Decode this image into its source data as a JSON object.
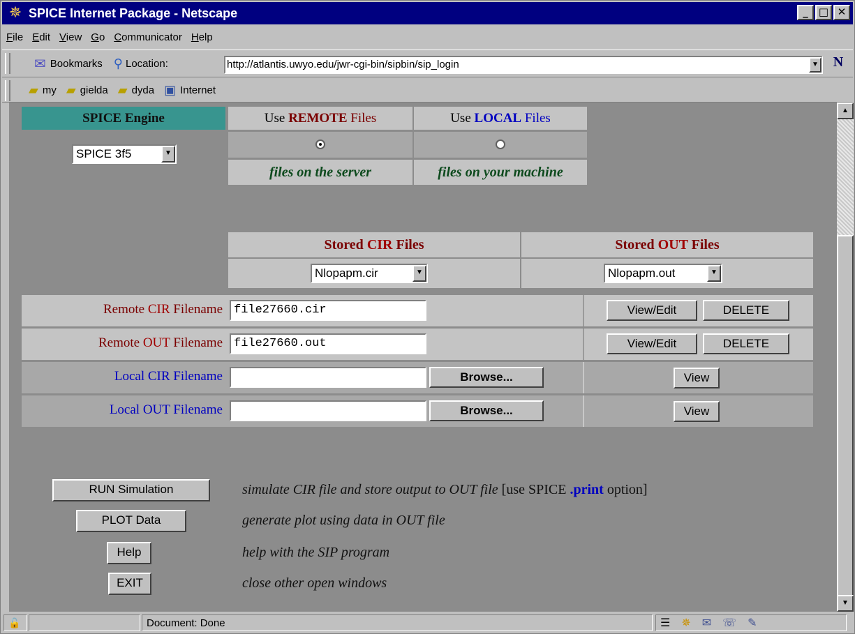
{
  "window": {
    "title": "SPICE Internet Package - Netscape",
    "min": "_",
    "max": "□",
    "close": "✕"
  },
  "menu": [
    "File",
    "Edit",
    "View",
    "Go",
    "Communicator",
    "Help"
  ],
  "location": {
    "bookmarks": "Bookmarks",
    "label": "Location:",
    "url": "http://atlantis.uwyo.edu/jwr-cgi-bin/sipbin/sip_login"
  },
  "personal": [
    {
      "label": "my"
    },
    {
      "label": "gielda"
    },
    {
      "label": "dyda"
    },
    {
      "label": "Internet"
    }
  ],
  "engine": {
    "header": "SPICE Engine",
    "selected": "SPICE 3f5"
  },
  "remote": {
    "pre": "Use ",
    "word": "REMOTE",
    "post": " Files",
    "desc": "files on the server",
    "selected": true
  },
  "local": {
    "pre": "Use ",
    "word": "LOCAL",
    "post": " Files",
    "desc": "files on your machine",
    "selected": false
  },
  "stored_cir": {
    "pre": "Stored ",
    "word": "CIR",
    "post": " Files",
    "selected": "Nlopapm.cir"
  },
  "stored_out": {
    "pre": "Stored ",
    "word": "OUT",
    "post": " Files",
    "selected": "Nlopapm.out"
  },
  "rows": {
    "remote_cir": {
      "pre": "Remote ",
      "word": "CIR",
      "post": " Filename",
      "value": "file27660.cir"
    },
    "remote_out": {
      "pre": "Remote ",
      "word": "OUT",
      "post": " Filename",
      "value": "file27660.out"
    },
    "local_cir": {
      "label": "Local CIR Filename",
      "value": ""
    },
    "local_out": {
      "label": "Local OUT Filename",
      "value": ""
    }
  },
  "buttons": {
    "view_edit": "View/Edit",
    "delete": "DELETE",
    "browse": "Browse...",
    "view": "View"
  },
  "actions": {
    "run": {
      "label": "RUN Simulation",
      "desc": "simulate CIR file and store output to OUT file",
      "note_pre": " [use SPICE ",
      "note_word": ".print",
      "note_post": " option]"
    },
    "plot": {
      "label": "PLOT Data",
      "desc": "generate plot using data in OUT file"
    },
    "help": {
      "label": "Help",
      "desc": "help with the SIP program"
    },
    "exit": {
      "label": "EXIT",
      "desc": "close other open windows"
    }
  },
  "status": {
    "text": "Document: Done"
  },
  "colors": {
    "title_bar": "#000080",
    "teal_header": "#38958f",
    "page_bg": "#8c8c8c",
    "remote_red": "#7a0000",
    "local_blue": "#0000c0"
  }
}
